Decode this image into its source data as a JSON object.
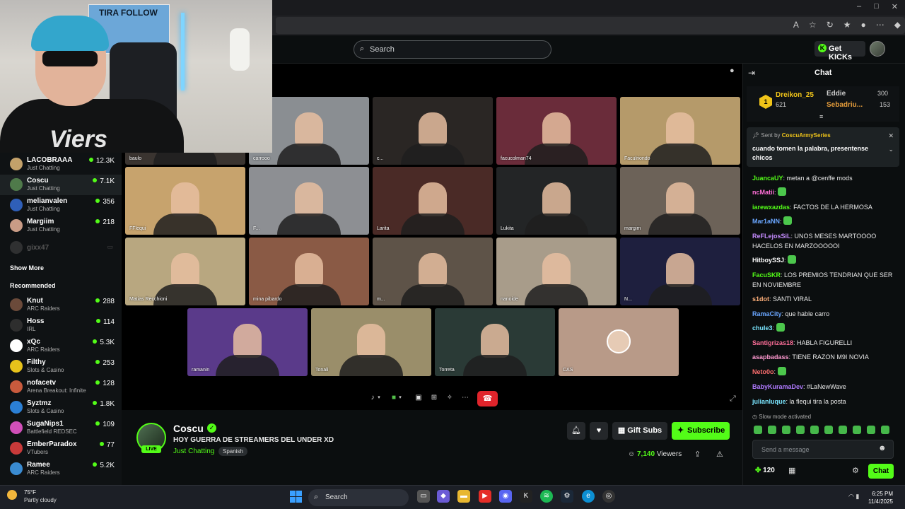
{
  "search": {
    "placeholder": "Search"
  },
  "header": {
    "get_kicks_label": "Get KICKs"
  },
  "webcam": {
    "poster_text": "TIRA FOLLOW"
  },
  "sidebar": {
    "following": [
      {
        "name": "LACOBRAAA",
        "sub": "Just Chatting",
        "count": "12.3K",
        "color": "#c3a16a"
      },
      {
        "name": "Coscu",
        "sub": "Just Chatting",
        "count": "7.1K",
        "color": "#4f7a4a",
        "active": true
      },
      {
        "name": "melianvalen",
        "sub": "Just Chatting",
        "count": "356",
        "color": "#2f5fb8"
      },
      {
        "name": "Margiim",
        "sub": "Just Chatting",
        "count": "218",
        "color": "#c99c86"
      }
    ],
    "offline": {
      "name": "gixx47"
    },
    "show_more": "Show More",
    "recommended_header": "Recommended",
    "recommended": [
      {
        "name": "Knut",
        "sub": "ARC Raiders",
        "count": "288",
        "color": "#6b4a3a"
      },
      {
        "name": "Hoss",
        "sub": "IRL",
        "count": "114",
        "color": "#2e2e2e"
      },
      {
        "name": "xQc",
        "sub": "ARC Raiders",
        "count": "5.3K",
        "color": "#ffffff"
      },
      {
        "name": "Filthy",
        "sub": "Slots & Casino",
        "count": "253",
        "color": "#e7c21b"
      },
      {
        "name": "nofacetv",
        "sub": "Arena Breakout: Infinite",
        "count": "128",
        "color": "#c85a3d"
      },
      {
        "name": "Syztmz",
        "sub": "Slots & Casino",
        "count": "1.8K",
        "color": "#2b7fd4"
      },
      {
        "name": "SugaNips1",
        "sub": "Battlefield REDSEC",
        "count": "109",
        "color": "#d04fb8"
      },
      {
        "name": "EmberParadox",
        "sub": "VTubers",
        "count": "77",
        "color": "#c83a3a"
      },
      {
        "name": "Ramee",
        "sub": "ARC Raiders",
        "count": "5.2K",
        "color": "#3a8bd1"
      }
    ]
  },
  "grid": {
    "row1": [
      {
        "name": "baulo",
        "bg": "#3a3430"
      },
      {
        "name": "carrooo",
        "bg": "#8a8e92"
      },
      {
        "name": "c...",
        "bg": "#2a2624"
      },
      {
        "name": "facucolman74",
        "bg": "#6a2c3a"
      },
      {
        "name": "Faculriondo",
        "bg": "#b59a6a"
      }
    ],
    "row2": [
      {
        "name": "FFlequi",
        "bg": "#c7a36d"
      },
      {
        "name": "F...",
        "bg": "#8d8f93"
      },
      {
        "name": "Larita",
        "bg": "#4a2a26"
      },
      {
        "name": "Lukita",
        "bg": "#232526"
      },
      {
        "name": "margim",
        "bg": "#6c6258"
      }
    ],
    "row3": [
      {
        "name": "Matias Recchioni",
        "bg": "#b8a780"
      },
      {
        "name": "mina pibardo",
        "bg": "#8a5a45"
      },
      {
        "name": "m...",
        "bg": "#5e5348"
      },
      {
        "name": "nanoide",
        "bg": "#a89c8a"
      },
      {
        "name": "N...",
        "bg": "#1e1f3e"
      }
    ],
    "row4": [
      {
        "name": "ramanin",
        "bg": "#5a3a8a"
      },
      {
        "name": "Tonali",
        "bg": "#9a8e6a"
      },
      {
        "name": "Torreta",
        "bg": "#2a3a36"
      },
      {
        "name": "CAS",
        "bg": "#b89a88"
      }
    ]
  },
  "stream": {
    "channel": "Coscu",
    "title": "HOY GUERRA DE STREAMERS DEL UNDER XD",
    "category": "Just Chatting",
    "language": "Spanish",
    "live": "LIVE",
    "gift_subs": "Gift Subs",
    "subscribe": "Subscribe",
    "viewers_count": "7,140",
    "viewers_label": "Viewers"
  },
  "chat": {
    "title": "Chat",
    "leaderboard": [
      {
        "name": "Dreikon_25",
        "count": "621",
        "color": "#f0c419"
      },
      {
        "name": "Eddie",
        "count": "300",
        "color": "#cfcfcf"
      },
      {
        "name": "Sebadriu...",
        "count": "153",
        "color": "#e39b3a"
      }
    ],
    "pinned": {
      "sent_by": "Sent by",
      "author": "CoscuArmySeries",
      "message": "cuando tomen la palabra, presentense chicos"
    },
    "messages": [
      {
        "user": "JuancaUY",
        "text": "metan a @cenffe mods",
        "color": "#53fc18"
      },
      {
        "user": "ncMatii",
        "text": "",
        "color": "#ff6fd8",
        "emote": true
      },
      {
        "user": "iarewxazdas",
        "text": "FACTOS DE LA HERMOSA",
        "color": "#53fc18"
      },
      {
        "user": "Mar1aNN",
        "text": "",
        "color": "#6aa6ff",
        "emote": true
      },
      {
        "user": "ReFLejosSiL",
        "text": "UNOS MESES MARTOOOO HACELOS EN MARZOOOOOI",
        "color": "#c58cff"
      },
      {
        "user": "HitboySSJ",
        "text": "",
        "color": "#ffffff",
        "emote": true
      },
      {
        "user": "FacuSKR",
        "text": "LOS PREMIOS TENDRIAN QUE SER EN NOVIEMBRE",
        "color": "#53fc18"
      },
      {
        "user": "s1dot",
        "text": "SANTI VIRAL",
        "color": "#ffb07a"
      },
      {
        "user": "RamaCity",
        "text": "que hable carro",
        "color": "#6aa6ff"
      },
      {
        "user": "chule3",
        "text": "",
        "color": "#7ae6ff",
        "emote": true
      },
      {
        "user": "Santigrizas18",
        "text": "HABLA FIGURELLI",
        "color": "#ff6f9a"
      },
      {
        "user": "asapbadass",
        "text": "TIENE RAZON M9I NOVIA",
        "color": "#ff9ad1"
      },
      {
        "user": "Neto0o",
        "text": "",
        "color": "#ff6f6f",
        "emote": true
      },
      {
        "user": "BabyKuramaDev",
        "text": "#LaNewWave",
        "color": "#b07aff"
      },
      {
        "user": "julianluque",
        "text": "la flequi tira la posta",
        "color": "#7ae6ff"
      }
    ],
    "slow_mode": "Slow mode activated",
    "input_placeholder": "Send a message",
    "points": "120",
    "send_label": "Chat"
  },
  "taskbar": {
    "temp": "75°F",
    "condition": "Partly cloudy",
    "search_label": "Search",
    "time": "6:25 PM",
    "date": "11/4/2025"
  }
}
